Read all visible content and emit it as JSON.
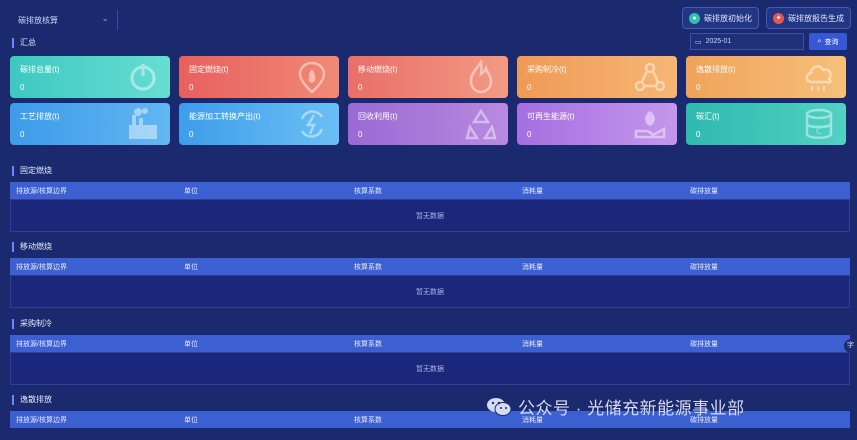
{
  "header": {
    "org_select": "碳排放核算",
    "btn_calc_label": "碳排放初始化",
    "btn_report_label": "碳排放报告生成"
  },
  "summary": {
    "title": "汇总",
    "date_value": "2025-01",
    "query_label": "查询",
    "cards": [
      {
        "label": "碳排总量(t)",
        "value": "0",
        "color1": "#3ec8c0",
        "color2": "#67ddd3",
        "icon": "power-icon"
      },
      {
        "label": "固定燃烧(t)",
        "value": "0",
        "color1": "#e8605e",
        "color2": "#f08a76",
        "icon": "flame-pin-icon"
      },
      {
        "label": "移动燃烧(t)",
        "value": "0",
        "color1": "#e96f6a",
        "color2": "#f39a83",
        "icon": "fire-icon"
      },
      {
        "label": "采购制冷(t)",
        "value": "0",
        "color1": "#ef9a56",
        "color2": "#f6b774",
        "icon": "network-icon"
      },
      {
        "label": "逸散排放(t)",
        "value": "0",
        "color1": "#f0a35a",
        "color2": "#f7c07a",
        "icon": "cloud-icon"
      },
      {
        "label": "工艺排放(t)",
        "value": "0",
        "color1": "#3d9bea",
        "color2": "#63b6f2",
        "icon": "factory-icon"
      },
      {
        "label": "能源加工转换产出(t)",
        "value": "0",
        "color1": "#3e9deb",
        "color2": "#6ac0f4",
        "icon": "energy-cycle-icon"
      },
      {
        "label": "回收利用(t)",
        "value": "0",
        "color1": "#9a69d4",
        "color2": "#b98ae0",
        "icon": "recycle-icon"
      },
      {
        "label": "可再生能源(t)",
        "value": "0",
        "color1": "#a56fe0",
        "color2": "#c497ec",
        "icon": "leaf-hand-icon"
      },
      {
        "label": "碳汇(t)",
        "value": "0",
        "color1": "#2fb9ae",
        "color2": "#52d1c4",
        "icon": "database-icon"
      }
    ]
  },
  "tables": [
    {
      "title": "固定燃烧",
      "columns": [
        "排放源/核算边界",
        "单位",
        "核算系数",
        "消耗量",
        "碳排放量"
      ],
      "empty_text": "暂无数据"
    },
    {
      "title": "移动燃烧",
      "columns": [
        "排放源/核算边界",
        "单位",
        "核算系数",
        "消耗量",
        "碳排放量"
      ],
      "empty_text": "暂无数据"
    },
    {
      "title": "采购制冷",
      "columns": [
        "排放源/核算边界",
        "单位",
        "核算系数",
        "消耗量",
        "碳排放量"
      ],
      "empty_text": "暂无数据"
    },
    {
      "title": "逸散排放",
      "columns": [
        "排放源/核算边界",
        "单位",
        "核算系数",
        "消耗量",
        "碳排放量"
      ],
      "empty_text": ""
    }
  ],
  "side_tab_label": "字",
  "watermark_text": "公众号 · 光储充新能源事业部"
}
